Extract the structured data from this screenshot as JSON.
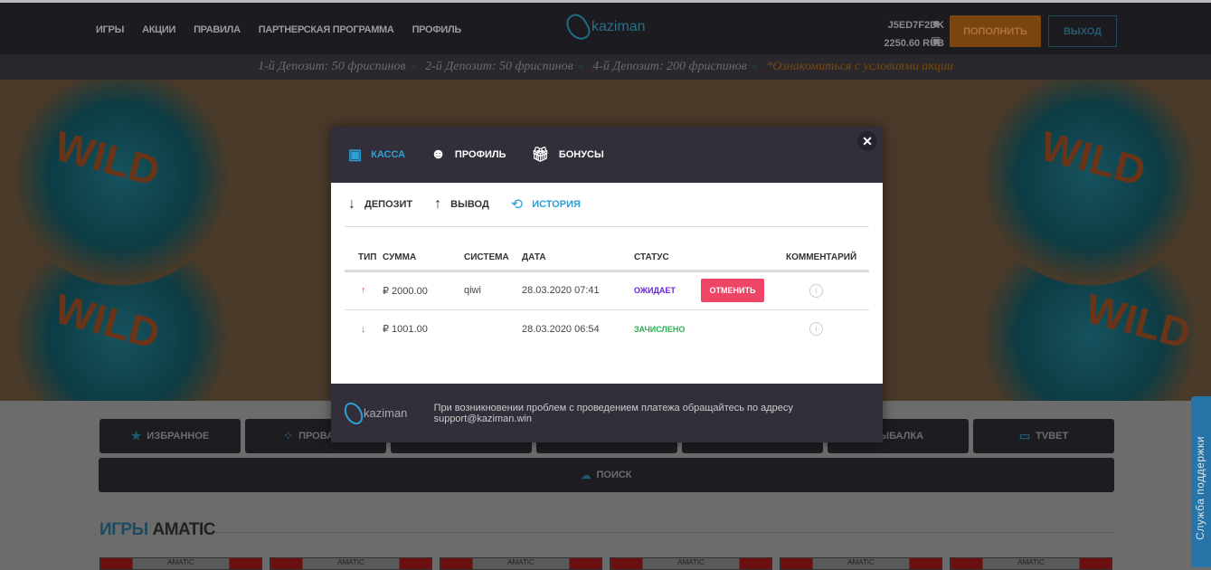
{
  "header": {
    "nav": [
      "ИГРЫ",
      "АКЦИИ",
      "ПРАВИЛА",
      "ПАРТНЕРСКАЯ ПРОГРАММА",
      "ПРОФИЛЬ"
    ],
    "logo": "kaziman",
    "user_id": "J5ED7F2DK",
    "balance": "2250.60 RUB",
    "deposit_button": "ПОПОЛНИТЬ",
    "logout_button": "ВЫХОД"
  },
  "promo": {
    "items": [
      "1-й Депозит: 50 фриспинов",
      "2-й Депозит: 50 фриспинов",
      "4-й Депозит: 200 фриспинов"
    ],
    "link": "*Ознакомиться с условиями акции"
  },
  "banner": {
    "text": "WILD"
  },
  "categories": [
    {
      "icon": "★",
      "label": "ИЗБРАННОЕ"
    },
    {
      "icon": "⁘",
      "label": "ПРОВАЙД"
    },
    {
      "icon": "",
      "label": ""
    },
    {
      "icon": "",
      "label": ""
    },
    {
      "icon": "",
      "label": ""
    },
    {
      "icon": "",
      "label": "РЫБАЛКА"
    },
    {
      "icon": "▭",
      "label": "TVBET"
    }
  ],
  "search_label": "ПОИСК",
  "games_title": {
    "accent": "ИГРЫ",
    "rest": " AMATIC"
  },
  "thumb_label": "AMATIC",
  "support_label": "Служба поддержки",
  "modal": {
    "tabs": [
      "КАССА",
      "ПРОФИЛЬ",
      "БОНУСЫ"
    ],
    "subtabs": [
      "ДЕПОЗИТ",
      "ВЫВОД",
      "ИСТОРИЯ"
    ],
    "columns": [
      "ТИП",
      "СУММА",
      "СИСТЕМА",
      "ДАТА",
      "СТАТУС",
      "",
      "КОММЕНТАРИЙ"
    ],
    "rows": [
      {
        "type": "↑",
        "amount": "₽  2000.00",
        "system": "qiwi",
        "date": "28.03.2020 07:41",
        "status": "ОЖИДАЕТ",
        "action": "ОТМЕНИТЬ"
      },
      {
        "type": "↓",
        "amount": "₽  1001.00",
        "system": "",
        "date": "28.03.2020 06:54",
        "status": "ЗАЧИСЛЕНО",
        "action": ""
      }
    ],
    "footer_logo": "kaziman",
    "footer_text": "При возникновении проблем с проведением платежа обращайтесь по адресу support@kaziman.win"
  }
}
